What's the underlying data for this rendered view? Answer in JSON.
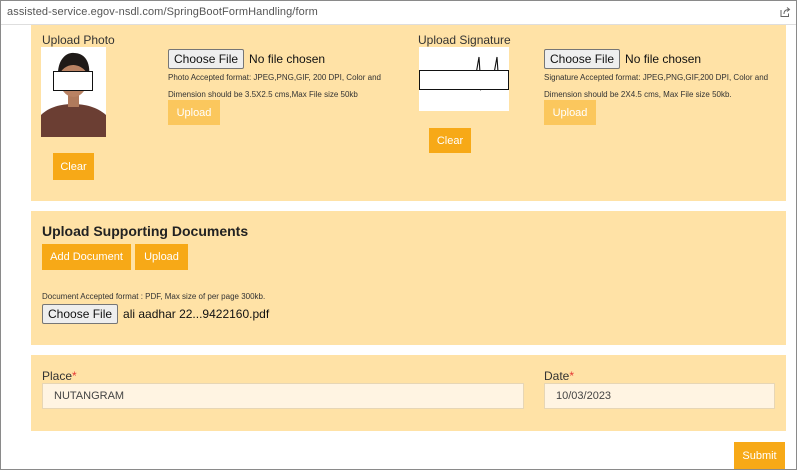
{
  "browser": {
    "url": "assisted-service.egov-nsdl.com/SpringBootFormHandling/form"
  },
  "photo_section": {
    "title": "Upload Photo",
    "choose_label": "Choose File",
    "file_status": "No file chosen",
    "hint": "Photo Accepted format: JPEG,PNG,GIF, 200 DPI, Color and Dimension should be 3.5X2.5 cms,Max File size 50kb",
    "upload_label": "Upload",
    "clear_label": "Clear"
  },
  "signature_section": {
    "title": "Upload Signature",
    "choose_label": "Choose File",
    "file_status": "No file chosen",
    "hint": "Signature Accepted format: JPEG,PNG,GIF,200 DPI, Color and Dimension should be 2X4.5 cms, Max File size 50kb.",
    "upload_label": "Upload",
    "clear_label": "Clear"
  },
  "documents_section": {
    "title": "Upload Supporting Documents",
    "add_label": "Add Document",
    "upload_label": "Upload",
    "hint": "Document Accepted format : PDF, Max size of per page 300kb.",
    "choose_label": "Choose File",
    "file_name": "ali aadhar 22...9422160.pdf"
  },
  "details": {
    "place_label": "Place",
    "place_value": "NUTANGRAM",
    "date_label": "Date",
    "date_value": "10/03/2023",
    "required_mark": "*"
  },
  "submit_label": "Submit",
  "colors": {
    "accent": "#f7a917",
    "accent_disabled": "#fbc75d",
    "panel_bg": "#ffe2a6",
    "required": "#e53935"
  }
}
